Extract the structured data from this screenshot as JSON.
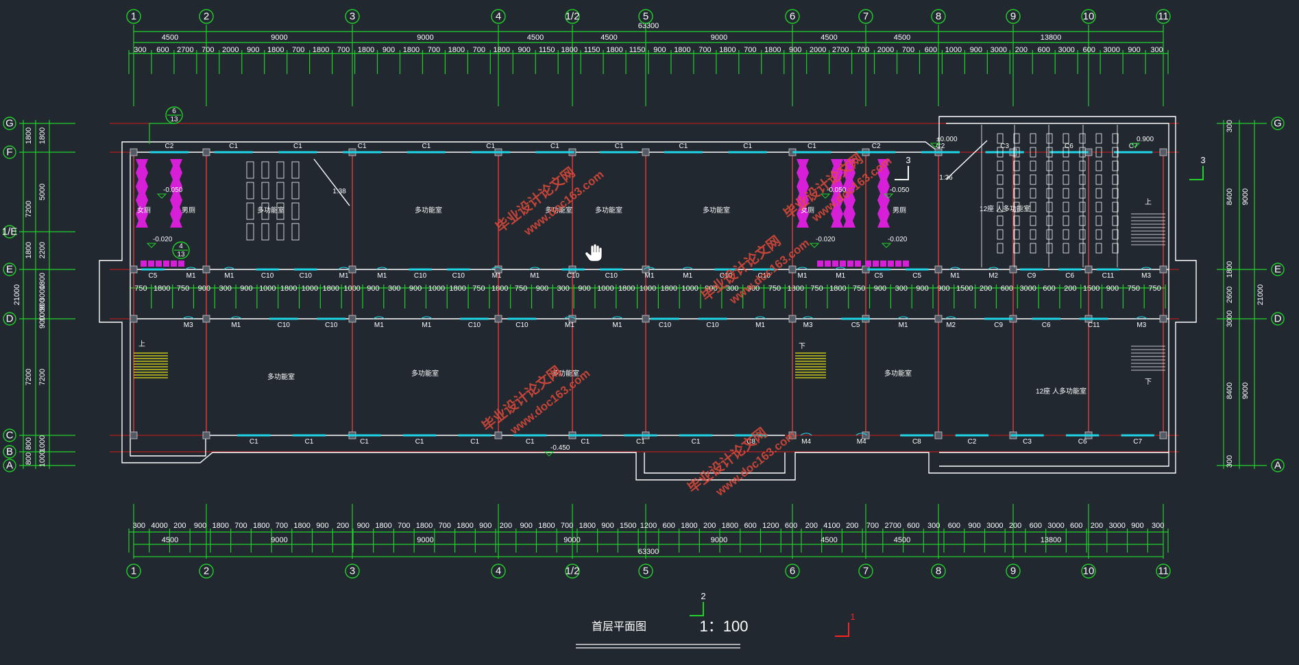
{
  "drawing": {
    "title": "首层平面图",
    "scale": "1：100",
    "total_dimension": "63300",
    "section_marks": [
      "3",
      "2",
      "1",
      "3"
    ],
    "callouts": [
      {
        "num": "6",
        "sheet": "13"
      },
      {
        "num": "4",
        "sheet": "13"
      }
    ]
  },
  "grid": {
    "columns": [
      "1",
      "2",
      "3",
      "4",
      "1/2",
      "5",
      "6",
      "7",
      "8",
      "9",
      "10",
      "11"
    ],
    "rows_left": [
      "G",
      "F",
      "1/E",
      "E",
      "D",
      "C",
      "B",
      "A"
    ],
    "rows_right": [
      "G",
      "E",
      "D",
      "A"
    ]
  },
  "dims": {
    "top_bays": [
      "4500",
      "9000",
      "9000",
      "4500",
      "4500",
      "9000",
      "4500",
      "4500",
      "13800"
    ],
    "top_details": [
      "300",
      "600",
      "2700",
      "700",
      "2000",
      "900",
      "1800",
      "700",
      "1800",
      "700",
      "1800",
      "900",
      "1800",
      "700",
      "1800",
      "700",
      "1800",
      "900",
      "1150",
      "1800",
      "1150",
      "1800",
      "1150",
      "900",
      "1800",
      "700",
      "1800",
      "700",
      "1800",
      "900",
      "2000",
      "2700",
      "700",
      "2000",
      "700",
      "600",
      "1000",
      "900",
      "3000",
      "200",
      "600",
      "3000",
      "600",
      "3000",
      "900",
      "300"
    ],
    "bottom_bays": [
      "4500",
      "9000",
      "9000",
      "9000",
      "9000",
      "4500",
      "4500",
      "13800"
    ],
    "bottom_details": [
      "300",
      "4000",
      "200",
      "900",
      "1800",
      "700",
      "1800",
      "700",
      "1800",
      "900",
      "200",
      "900",
      "1800",
      "700",
      "1800",
      "700",
      "1800",
      "900",
      "200",
      "900",
      "1800",
      "700",
      "1800",
      "900",
      "1500",
      "1200",
      "600",
      "1800",
      "200",
      "1800",
      "600",
      "1200",
      "600",
      "200",
      "4100",
      "200",
      "700",
      "2700",
      "600",
      "300",
      "600",
      "900",
      "3000",
      "200",
      "600",
      "3000",
      "600",
      "200",
      "3000",
      "900",
      "300"
    ],
    "left_totals": [
      "1800",
      "7200",
      "1800",
      "7200",
      "800",
      "800",
      "21000"
    ],
    "left_details": [
      "1800",
      "5000",
      "2200",
      "1800",
      "3000",
      "900",
      "1000",
      "900",
      "7200",
      "1000",
      "1000"
    ],
    "right_details": [
      "300",
      "8400",
      "1800",
      "2600",
      "3000",
      "8400",
      "300"
    ],
    "right_totals": [
      "9000",
      "21000",
      "9000"
    ],
    "corridor_dims": [
      "750",
      "1800",
      "750",
      "900",
      "300",
      "900",
      "1000",
      "1800",
      "1000",
      "1800",
      "1000",
      "900",
      "300",
      "900",
      "1000",
      "1800",
      "750",
      "1800",
      "750",
      "900",
      "300",
      "900",
      "1000",
      "1800",
      "1000",
      "1800",
      "1000",
      "900",
      "300",
      "900",
      "750",
      "1800",
      "750",
      "1800",
      "750",
      "900",
      "300",
      "900",
      "900",
      "1500",
      "200",
      "600",
      "3000",
      "600",
      "200",
      "1500",
      "900",
      "750",
      "750"
    ]
  },
  "openings": {
    "windows_top": [
      "C2",
      "C1",
      "C1",
      "C1",
      "C1",
      "C1",
      "C1",
      "C1",
      "C1",
      "C1",
      "C1",
      "C2",
      "C2",
      "C3",
      "C6",
      "C7"
    ],
    "windows_corridor_n": [
      "C5",
      "M1",
      "M1",
      "C10",
      "C10",
      "M1",
      "M1",
      "C10",
      "C10",
      "M1",
      "M1",
      "C10",
      "C10",
      "M1",
      "M1",
      "C10",
      "C10",
      "M1",
      "M1",
      "C5",
      "C5",
      "M1",
      "M2",
      "C9",
      "C6",
      "C11",
      "M3"
    ],
    "windows_corridor_s": [
      "M3",
      "M1",
      "C10",
      "C10",
      "M1",
      "M1",
      "C10",
      "C10",
      "M1",
      "M1",
      "C10",
      "C10",
      "M1",
      "M3",
      "C5",
      "M1",
      "M2",
      "C9",
      "C6",
      "C11",
      "M3"
    ],
    "windows_bottom": [
      "C1",
      "C1",
      "C1",
      "C1",
      "C1",
      "C1",
      "C1",
      "C1",
      "C1",
      "C8",
      "M4",
      "M4",
      "C8",
      "C2",
      "C3",
      "C6",
      "C7"
    ]
  },
  "levels": [
    "±0.000",
    "0.900",
    "-0.050",
    "-0.020",
    "-0.050",
    "-0.050",
    "-0.020",
    "-0.020",
    "-0.450"
  ],
  "rooms": [
    "女厕",
    "男厕",
    "女厕",
    "男厕",
    "多功能室",
    "多功能室",
    "多功能室",
    "多功能室",
    "多功能室",
    "多功能室",
    "多功能室",
    "多功能室",
    "多功能室",
    "12座 人多功能室",
    "12座 人多功能室"
  ],
  "ramp_labels": [
    "1:38",
    "1:36"
  ],
  "stair_labels": [
    "上",
    "下",
    "上",
    "下"
  ],
  "watermarks": [
    "毕业设计论文网",
    "www.doc163.com"
  ]
}
